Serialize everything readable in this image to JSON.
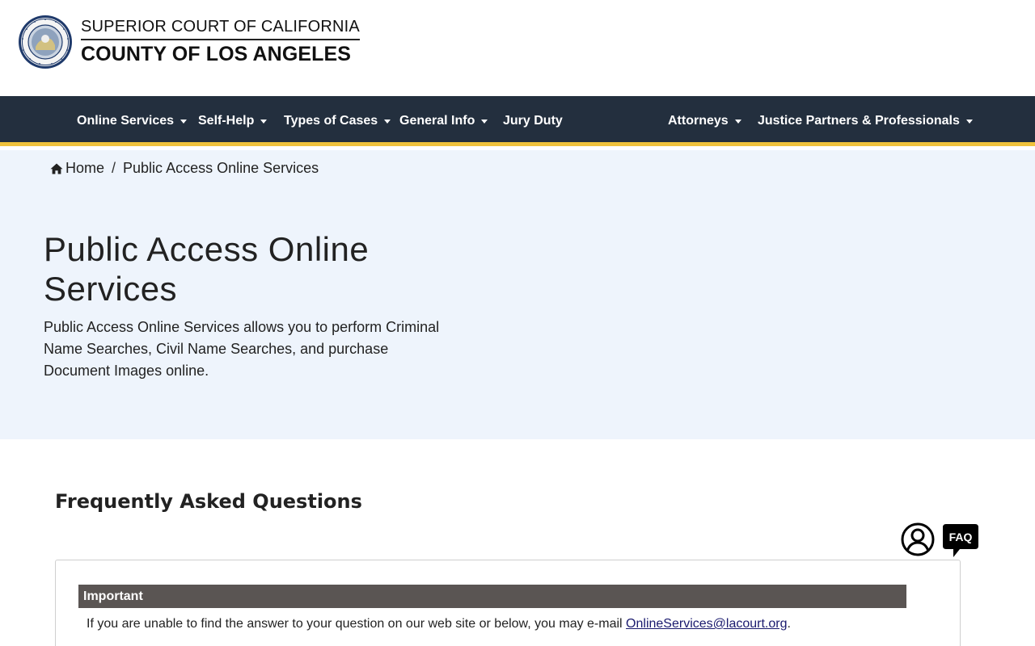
{
  "header": {
    "court_name_line1": "SUPERIOR COURT OF CALIFORNIA",
    "court_name_line2": "COUNTY OF LOS ANGELES"
  },
  "nav": {
    "items": [
      {
        "label": "Online Services",
        "dropdown": true
      },
      {
        "label": "Self-Help",
        "dropdown": true
      },
      {
        "label": "Types of Cases",
        "dropdown": true
      },
      {
        "label": "General Info",
        "dropdown": true
      },
      {
        "label": "Jury Duty",
        "dropdown": false
      },
      {
        "label": "Attorneys",
        "dropdown": true
      },
      {
        "label": "Justice Partners & Professionals",
        "dropdown": true
      }
    ]
  },
  "breadcrumb": {
    "home": "Home",
    "separator": "/",
    "current": "Public Access Online Services"
  },
  "hero": {
    "title": "Public Access Online Services",
    "description": "Public Access Online Services allows you to perform Criminal Name Searches, Civil Name Searches, and purchase Document Images online."
  },
  "faq": {
    "heading": "Frequently Asked Questions",
    "faq_icon_text": "FAQ",
    "important_label": "Important",
    "important_text": "If you are unable to find the answer to your question on our web site or below, you may e-mail ",
    "email": "OnlineServices@lacourt.org",
    "important_text_end": "."
  },
  "colors": {
    "navbar": "#232f3e",
    "navbar_accent": "#f0c23b",
    "hero_bg": "#eef4fc",
    "important_bar": "#5a5553"
  },
  "icons": [
    "court-seal-icon",
    "home-icon",
    "caret-down-icon",
    "user-icon",
    "faq-icon"
  ]
}
